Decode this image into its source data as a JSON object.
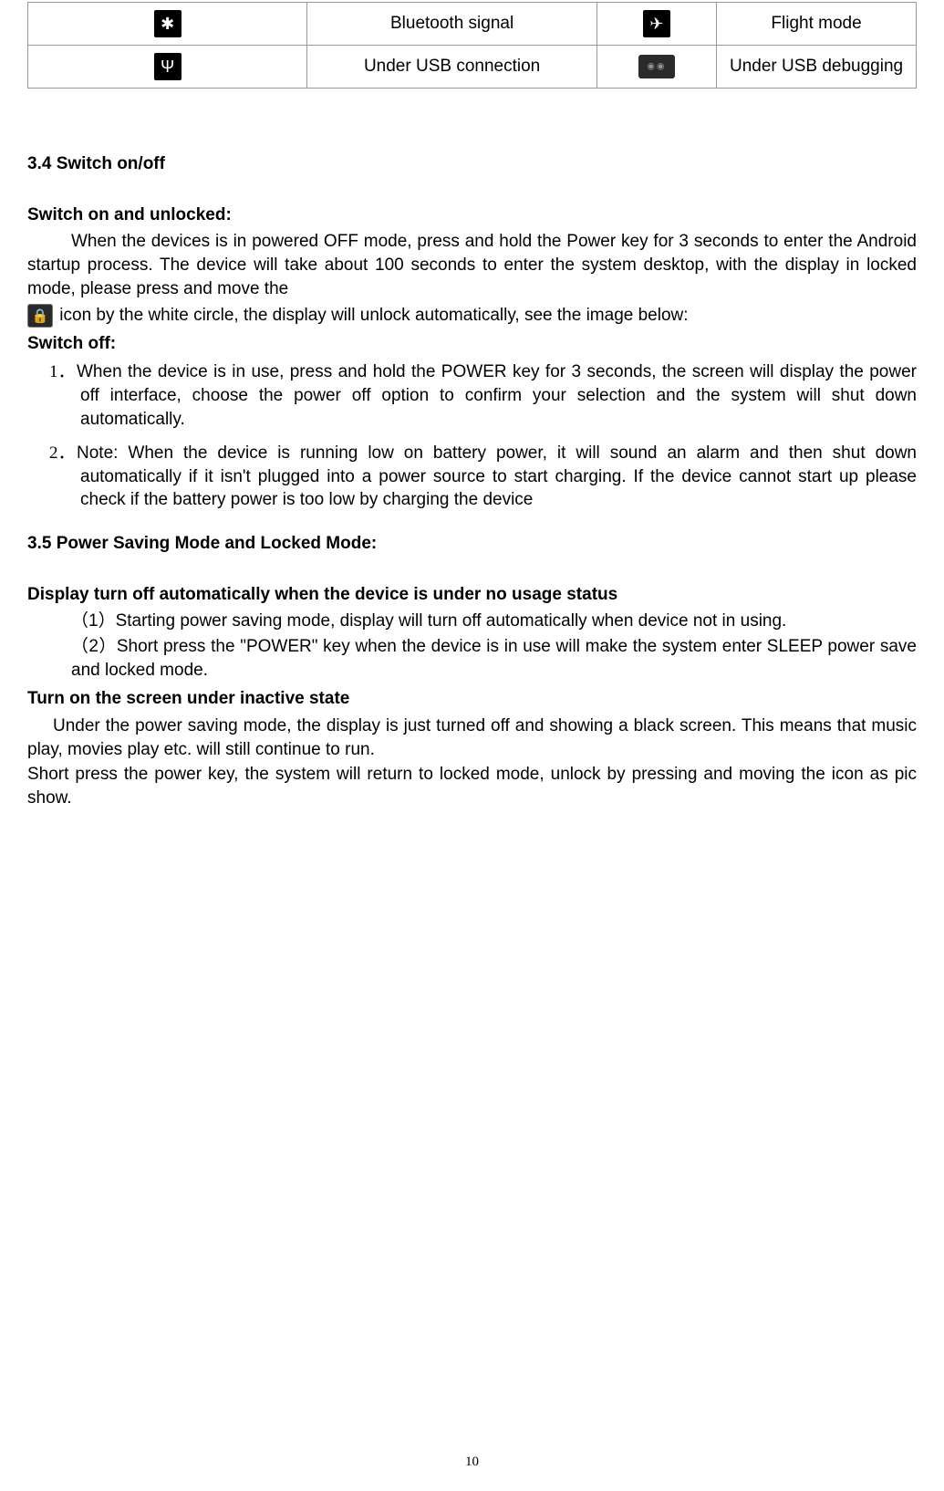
{
  "icon_table": {
    "rows": [
      {
        "icon1_name": "bluetooth-icon",
        "icon1_glyph": "✱",
        "label1": "Bluetooth signal",
        "icon2_name": "airplane-icon",
        "icon2_glyph": "✈",
        "label2": "Flight mode"
      },
      {
        "icon1_name": "usb-icon",
        "icon1_glyph": "Ψ",
        "label1": "Under USB connection",
        "icon2_name": "android-icon",
        "icon2_glyph": "",
        "label2": "Under USB debugging"
      }
    ]
  },
  "section34": {
    "heading": "3.4 Switch on/off",
    "sub1": "Switch on and unlocked:",
    "para1a": "When the devices is in powered OFF mode, press and hold the Power key for 3 seconds to enter the Android startup process. The device will take about 100 seconds to enter the system desktop, with the display in locked mode, please press and move the",
    "lock_icon_name": "lock-icon",
    "lock_glyph": "🔒",
    "para1b": " icon by the white circle, the display will unlock automatically, see the image below:",
    "sub2": "Switch off:",
    "items": {
      "n1": "1．",
      "t1": "When the device is in use, press and hold the POWER key for 3 seconds, the screen will display the power off interface, choose the power off option to confirm your selection and the system will shut down automatically.",
      "n2": "2．",
      "t2": "Note: When the device is running low on battery power, it will sound an alarm and then shut down automatically if it isn't plugged into a power source to start charging. If the device cannot start up please check if the battery power is too low by charging the device"
    }
  },
  "section35": {
    "heading": "3.5 Power Saving Mode and Locked Mode:",
    "sub1": "Display turn off automatically when the device is under no usage status",
    "p1": "（1）Starting power saving mode, display will turn off automatically when device not in using.",
    "p2": "（2）Short press the \"POWER\" key when the device is in use will make the system enter SLEEP power save and locked mode.",
    "sub2": "Turn on the screen under inactive state",
    "p3": "Under the power saving mode, the display is just turned off and showing a black screen. This means that music play, movies play etc. will still continue to run.",
    "p4": "Short press the power key, the system will return to locked mode, unlock by pressing and moving the icon as pic show."
  },
  "page_number": "10"
}
